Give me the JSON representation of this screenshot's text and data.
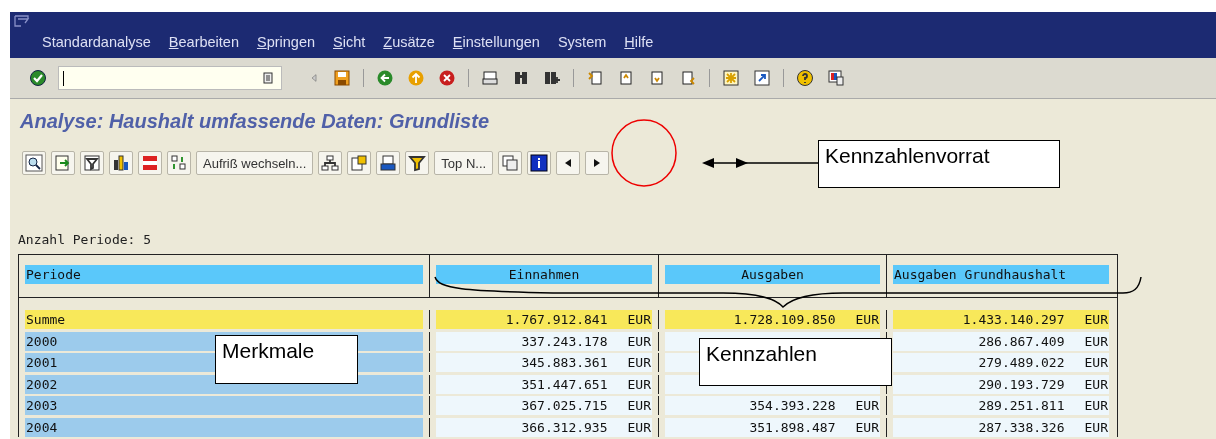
{
  "menu": [
    {
      "label": "Standardanalyse",
      "underlined": false
    },
    {
      "label": "Bearbeiten",
      "underlined": true
    },
    {
      "label": "Springen",
      "underlined": true
    },
    {
      "label": "Sicht",
      "underlined": true
    },
    {
      "label": "Zusätze",
      "underlined": true
    },
    {
      "label": "Einstellungen",
      "underlined": true
    },
    {
      "label": "System",
      "underlined": false
    },
    {
      "label": "Hilfe",
      "underlined": true
    }
  ],
  "title": "Analyse: Haushalt umfassende Daten: Grundliste",
  "app_toolbar": {
    "buttons": [
      "Aufriß wechseln...",
      "Top N..."
    ]
  },
  "info": "Anzahl Periode: 5",
  "table": {
    "columns": [
      "Periode",
      "Einnahmen",
      "Ausgaben",
      "Ausgaben Grundhaushalt"
    ],
    "rows": [
      {
        "kind": "total",
        "cells": [
          {
            "value": "Summe"
          },
          {
            "value": "1.767.912.841",
            "unit": "EUR"
          },
          {
            "value": "1.728.109.850",
            "unit": "EUR"
          },
          {
            "value": "1.433.140.297",
            "unit": "EUR"
          }
        ]
      },
      {
        "kind": "period",
        "cells": [
          {
            "value": "2000"
          },
          {
            "value": "337.243.178",
            "unit": "EUR"
          },
          null,
          {
            "value": "286.867.409",
            "unit": "EUR"
          }
        ]
      },
      {
        "kind": "period",
        "cells": [
          {
            "value": "2001"
          },
          {
            "value": "345.883.361",
            "unit": "EUR"
          },
          null,
          {
            "value": "279.489.022",
            "unit": "EUR"
          }
        ]
      },
      {
        "kind": "period",
        "cells": [
          {
            "value": "2002"
          },
          {
            "value": "351.447.651",
            "unit": "EUR"
          },
          null,
          {
            "value": "290.193.729",
            "unit": "EUR"
          }
        ]
      },
      {
        "kind": "period",
        "cells": [
          {
            "value": "2003"
          },
          {
            "value": "367.025.715",
            "unit": "EUR"
          },
          {
            "value": "354.393.228",
            "unit": "EUR"
          },
          {
            "value": "289.251.811",
            "unit": "EUR"
          }
        ]
      },
      {
        "kind": "period",
        "cells": [
          {
            "value": "2004"
          },
          {
            "value": "366.312.935",
            "unit": "EUR"
          },
          {
            "value": "351.898.487",
            "unit": "EUR"
          },
          {
            "value": "287.338.326",
            "unit": "EUR"
          }
        ]
      }
    ]
  },
  "annotations": {
    "toolbar_callout": "Kennzahlenvorrat",
    "rows_callout": "Merkmale",
    "columns_callout": "Kennzahlen"
  }
}
